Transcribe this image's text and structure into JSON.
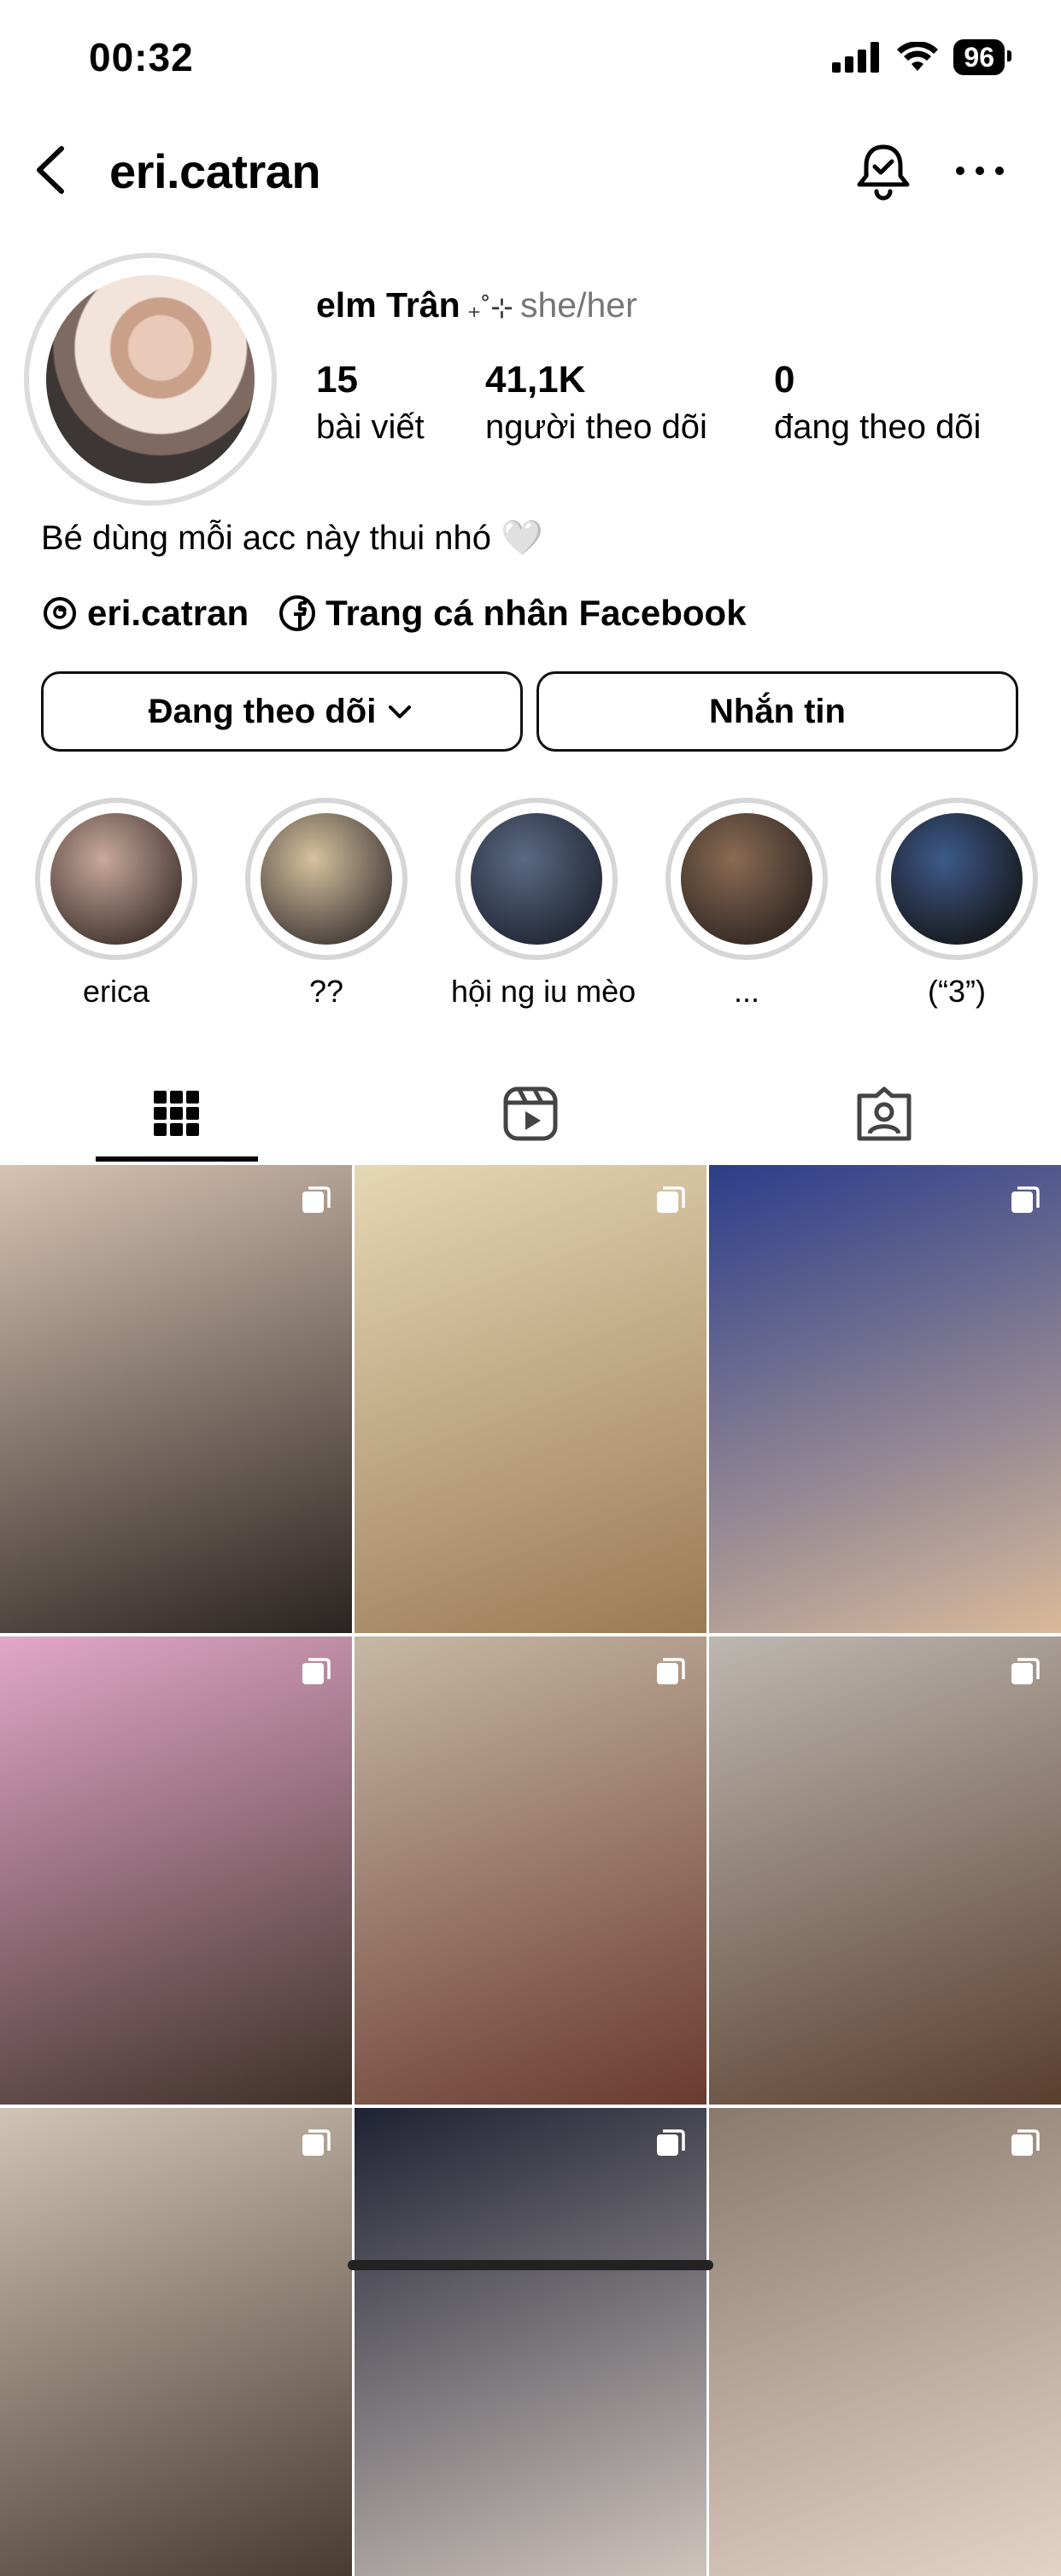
{
  "status": {
    "time": "00:32",
    "battery": "96"
  },
  "header": {
    "username": "eri.catran"
  },
  "profile": {
    "display_name": "elm Trân",
    "decoration": "₊˚⊹",
    "pronouns": "she/her",
    "stats": [
      {
        "value": "15",
        "label": "bài viết"
      },
      {
        "value": "41,1K",
        "label": "người theo dõi"
      },
      {
        "value": "0",
        "label": "đang theo dõi"
      }
    ],
    "bio": "Bé dùng mỗi acc này thui nhó 🤍",
    "threads_handle": "eri.catran",
    "facebook_link": "Trang cá nhân Facebook"
  },
  "buttons": {
    "following": "Đang theo dõi",
    "message": "Nhắn tin"
  },
  "highlights": [
    {
      "label": "erica",
      "colors": [
        "#c9a99a",
        "#3a2d2a"
      ]
    },
    {
      "label": "??",
      "colors": [
        "#d7c2a0",
        "#3a3330"
      ]
    },
    {
      "label": "hội ng iu mèo",
      "colors": [
        "#5a6a84",
        "#1e2230"
      ]
    },
    {
      "label": "...",
      "colors": [
        "#8a6b52",
        "#2d2420"
      ]
    },
    {
      "label": "(“3”)",
      "colors": [
        "#3d5a8a",
        "#141414"
      ]
    }
  ],
  "tabs": [
    {
      "name": "grid-icon",
      "active": true
    },
    {
      "name": "reels-icon",
      "active": false
    },
    {
      "name": "tagged-icon",
      "active": false
    }
  ],
  "posts": [
    {
      "bg": [
        "#d8c3b2",
        "#2a2321"
      ],
      "multi": true
    },
    {
      "bg": [
        "#e6d7b5",
        "#9a7a54"
      ],
      "multi": true
    },
    {
      "bg": [
        "#2b3d8a",
        "#d9b99a"
      ],
      "multi": true
    },
    {
      "bg": [
        "#e2a7c8",
        "#3e3028"
      ],
      "multi": true
    },
    {
      "bg": [
        "#c7b8a4",
        "#6a3a30"
      ],
      "multi": true
    },
    {
      "bg": [
        "#bdb7b1",
        "#5a3e2e"
      ],
      "multi": true
    },
    {
      "bg": [
        "#d1c4b4",
        "#4a3b32"
      ],
      "multi": true
    },
    {
      "bg": [
        "#1f2233",
        "#cfc4bd"
      ],
      "multi": true
    },
    {
      "bg": [
        "#8a7a6d",
        "#e5d2c7"
      ],
      "multi": true
    }
  ]
}
